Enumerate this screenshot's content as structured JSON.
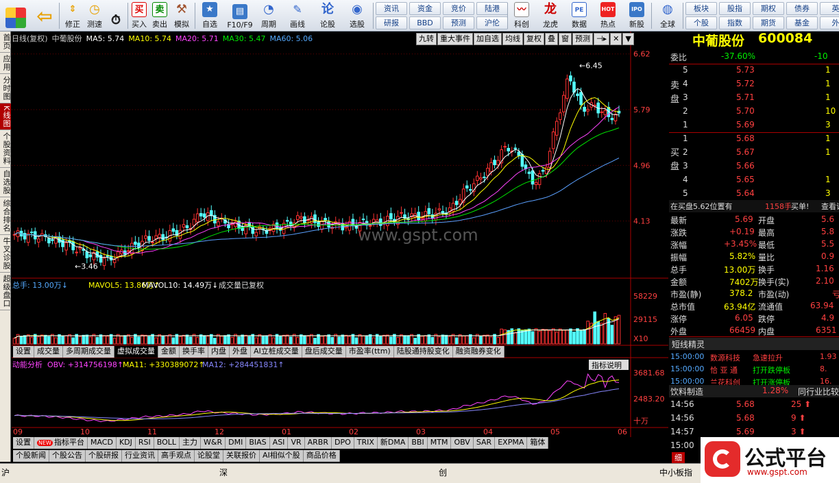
{
  "toolbar": {
    "items": [
      {
        "name": "home-button",
        "label": ""
      },
      {
        "name": "back-button",
        "label": ""
      },
      {
        "name": "revise-button",
        "label": "修正"
      },
      {
        "name": "speed-button",
        "label": "测速"
      },
      {
        "name": "buy-button",
        "label": "买入",
        "icon": "买"
      },
      {
        "name": "sell-button",
        "label": "卖出",
        "icon": "卖"
      },
      {
        "name": "simulate-button",
        "label": "模拟"
      },
      {
        "name": "watchlist-button",
        "label": "自选"
      },
      {
        "name": "f10-button",
        "label": "F10/F9"
      },
      {
        "name": "period-button",
        "label": "周期"
      },
      {
        "name": "draw-button",
        "label": "画线"
      },
      {
        "name": "forum-button",
        "label": "论股",
        "icon": "论"
      },
      {
        "name": "select-stock-button",
        "label": "选股"
      }
    ],
    "small_buttons": [
      [
        "资讯",
        "资金",
        "竞价",
        "陆港"
      ],
      [
        "研报",
        "BBD",
        "预测",
        "沪伦"
      ]
    ],
    "items2": [
      {
        "name": "sci-board-button",
        "label": "科创"
      },
      {
        "name": "dragon-tiger-button",
        "label": "龙虎"
      },
      {
        "name": "data-button",
        "label": "数据",
        "icon": "PE"
      },
      {
        "name": "hot-button",
        "label": "热点",
        "icon": "HOT"
      },
      {
        "name": "ipo-button",
        "label": "新股",
        "icon": "IPO"
      },
      {
        "name": "global-button",
        "label": "全球"
      }
    ],
    "small_buttons2": [
      [
        "板块",
        "股指",
        "期权",
        "债券",
        "英"
      ],
      [
        "个股",
        "指数",
        "期货",
        "基金",
        "外"
      ]
    ]
  },
  "left_tabs": [
    "首页",
    "应用",
    "分时图",
    "K线图",
    "个股资料",
    "自选股",
    "综合排名",
    "牛叉诊股",
    "超级盘口"
  ],
  "chart_info": {
    "title": "日线(复权)",
    "stock": "中葡股份",
    "ma5": "MA5: 5.74",
    "ma10": "MA10: 5.74",
    "ma20": "MA20: 5.71",
    "ma30": "MA30: 5.47",
    "ma60": "MA60: 5.06"
  },
  "chart_tools": [
    "九转",
    "重大事件",
    "加自选",
    "均线",
    "复权",
    "叠",
    "窗",
    "预测"
  ],
  "watermark": "www.gspt.com",
  "price_axis": [
    "6.62",
    "5.79",
    "4.96",
    "4.13"
  ],
  "high_label": "6.45",
  "low_label": "3.46",
  "vol_info": {
    "total": "总手: 13.00万",
    "mavol5": "MAVOL5: 13.86万",
    "mavol10": "MAVOL10: 14.49万",
    "note": "成交量已复权"
  },
  "vol_axis": [
    "58229",
    "29115",
    "X10"
  ],
  "vol_tabs": [
    "设置",
    "成交量",
    "多周期成交量",
    "虚拟成交量",
    "金额",
    "换手率",
    "内盘",
    "外盘",
    "AI立桩成交量",
    "盘后成交量",
    "市盈率(ttm)",
    "陆股通持股变化",
    "融资融券变化"
  ],
  "ind_info": {
    "name": "动能分析",
    "obv": "OBV: +314756198",
    "ma11": "MA11: +330389072",
    "ma12": "MA12: +284451831",
    "button": "指标说明"
  },
  "ind_axis": [
    "3681.68",
    "2483.20",
    "十万"
  ],
  "months": [
    "09",
    "10",
    "11",
    "12",
    "01",
    "02",
    "03",
    "04",
    "05",
    "06"
  ],
  "ind_tabs": [
    "设置",
    "指标平台",
    "MACD",
    "KDJ",
    "RSI",
    "BOLL",
    "主力",
    "W&R",
    "DMI",
    "BIAS",
    "ASI",
    "VR",
    "ARBR",
    "DPO",
    "TRIX",
    "新DMA",
    "BBI",
    "MTM",
    "OBV",
    "SAR",
    "EXPMA",
    "箱体"
  ],
  "new_badge": "NEW",
  "news_tabs": [
    "个股新闻",
    "个股公告",
    "个股研报",
    "行业资讯",
    "高手观点",
    "论股堂",
    "关联报价",
    "AI相似个股",
    "商品价格"
  ],
  "quote": {
    "name": "中葡股份",
    "code": "600084",
    "weibi_label": "委比",
    "weibi": "-37.60%",
    "weicha": "-10",
    "sell_label": "卖盘",
    "buy_label": "买盘",
    "sells": [
      [
        "5",
        "5.73",
        "1"
      ],
      [
        "4",
        "5.72",
        "1"
      ],
      [
        "3",
        "5.71",
        "1"
      ],
      [
        "2",
        "5.70",
        "10"
      ],
      [
        "1",
        "5.69",
        "3"
      ]
    ],
    "buys": [
      [
        "1",
        "5.68",
        "1"
      ],
      [
        "2",
        "5.67",
        "1"
      ],
      [
        "3",
        "5.66",
        ""
      ],
      [
        "4",
        "5.65",
        "1"
      ],
      [
        "5",
        "5.64",
        "3"
      ]
    ],
    "notice": "在买盘5.62位置有",
    "notice_vol": "1158手",
    "notice_tag": "买单!",
    "notice_link": "查看详",
    "stats": [
      [
        "最新",
        "5.69",
        "开盘",
        "5.6"
      ],
      [
        "涨跌",
        "+0.19",
        "最高",
        "5.8"
      ],
      [
        "涨幅",
        "+3.45%",
        "最低",
        "5.5"
      ],
      [
        "振幅",
        "5.82%",
        "量比",
        "0.9"
      ],
      [
        "总手",
        "13.00万",
        "换手",
        "1.16"
      ],
      [
        "金额",
        "7402万",
        "换手(实)",
        "2.10"
      ],
      [
        "市盈(静)",
        "378.2",
        "市盈(动)",
        "亏"
      ],
      [
        "总市值",
        "63.94亿",
        "流通值",
        "63.94"
      ],
      [
        "涨停",
        "6.05",
        "跌停",
        "4.9"
      ],
      [
        "外盘",
        "66459",
        "内盘",
        "6351"
      ]
    ],
    "elves_title": "短线精灵",
    "elves": [
      [
        "15:00:00",
        "数源科技",
        "急速拉升",
        "1.93"
      ],
      [
        "15:00:00",
        "恰 亚 通",
        "打开跌停板",
        "8."
      ],
      [
        "15:00:00",
        "兰花科创",
        "打开涨停板",
        "16."
      ]
    ],
    "industry": "饮料制造",
    "industry_pct": "1.28%",
    "industry_cmp": "同行业比较",
    "ticks": [
      [
        "14:56",
        "5.68",
        "25"
      ],
      [
        "14:56",
        "5.68",
        "9"
      ],
      [
        "14:57",
        "5.69",
        "3"
      ],
      [
        "15:00",
        "",
        ""
      ]
    ],
    "detail_tab": "细"
  },
  "bottom": {
    "labels": [
      "沪",
      "深",
      "创",
      "中小板指"
    ]
  },
  "logo": {
    "text": "公式平台",
    "url": "www.gspt.com"
  },
  "colors": {
    "up": "#ff3232",
    "down": "#54ffff",
    "ma5": "#ffffff",
    "ma10": "#ffff00",
    "ma20": "#ff44ff",
    "ma30": "#00e600",
    "ma60": "#5aa0ff"
  }
}
